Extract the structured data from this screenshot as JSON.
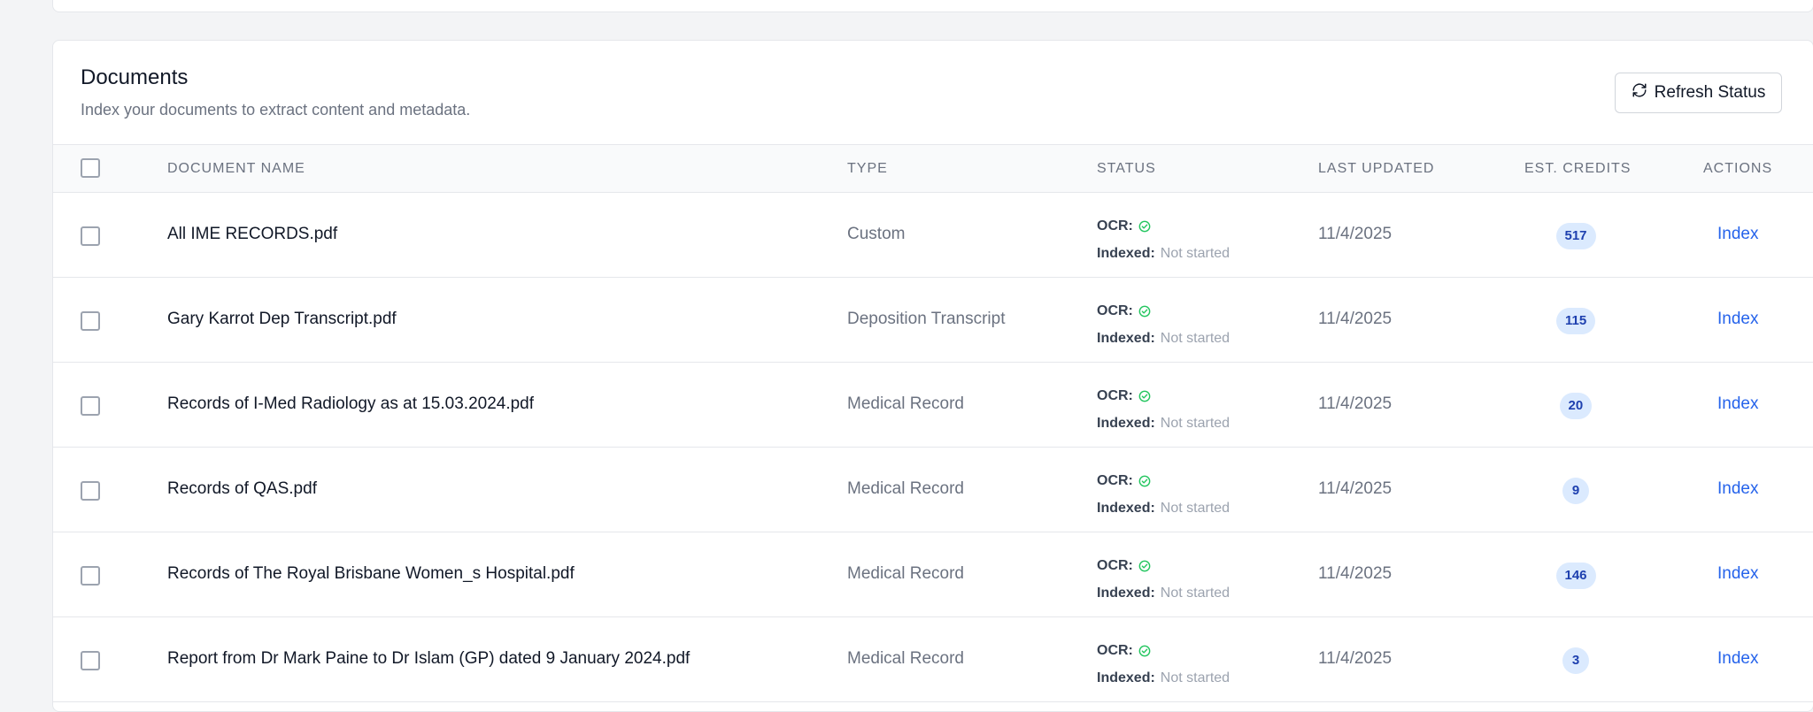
{
  "header": {
    "title": "Documents",
    "subtitle": "Index your documents to extract content and metadata.",
    "refresh_label": "Refresh Status"
  },
  "columns": {
    "name": "DOCUMENT NAME",
    "type": "TYPE",
    "status": "STATUS",
    "updated": "LAST UPDATED",
    "credits": "EST. CREDITS",
    "actions": "ACTIONS"
  },
  "status_labels": {
    "ocr": "OCR:",
    "indexed": "Indexed:"
  },
  "rows": [
    {
      "name": "All IME RECORDS.pdf",
      "type": "Custom",
      "ocr_done": true,
      "indexed": "Not started",
      "updated": "11/4/2025",
      "credits": "517",
      "action": "Index"
    },
    {
      "name": "Gary Karrot Dep Transcript.pdf",
      "type": "Deposition Transcript",
      "ocr_done": true,
      "indexed": "Not started",
      "updated": "11/4/2025",
      "credits": "115",
      "action": "Index"
    },
    {
      "name": "Records of I-Med Radiology as at 15.03.2024.pdf",
      "type": "Medical Record",
      "ocr_done": true,
      "indexed": "Not started",
      "updated": "11/4/2025",
      "credits": "20",
      "action": "Index"
    },
    {
      "name": "Records of QAS.pdf",
      "type": "Medical Record",
      "ocr_done": true,
      "indexed": "Not started",
      "updated": "11/4/2025",
      "credits": "9",
      "action": "Index"
    },
    {
      "name": "Records of The Royal Brisbane Women_s Hospital.pdf",
      "type": "Medical Record",
      "ocr_done": true,
      "indexed": "Not started",
      "updated": "11/4/2025",
      "credits": "146",
      "action": "Index"
    },
    {
      "name": "Report from Dr Mark Paine to Dr Islam (GP) dated 9 January 2024.pdf",
      "type": "Medical Record",
      "ocr_done": true,
      "indexed": "Not started",
      "updated": "11/4/2025",
      "credits": "3",
      "action": "Index"
    }
  ],
  "colors": {
    "accent": "#2563eb",
    "badge_bg": "#dbeafe",
    "badge_text": "#1e40af",
    "success": "#22c55e"
  }
}
